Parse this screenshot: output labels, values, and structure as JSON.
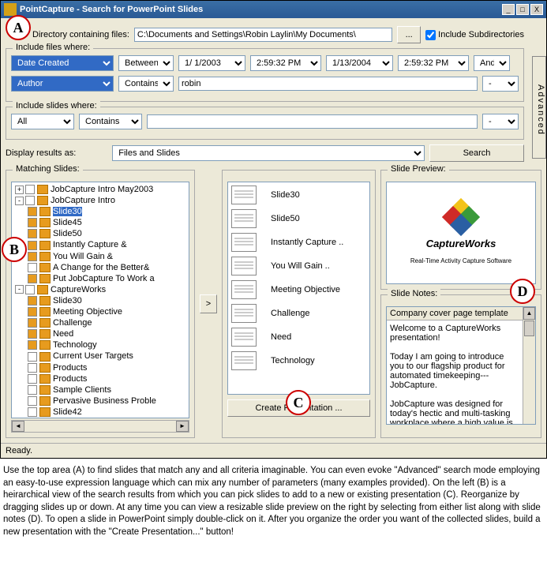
{
  "window": {
    "title": "PointCapture - Search for PowerPoint Slides",
    "min": "_",
    "max": "□",
    "close": "X"
  },
  "search": {
    "dir_label": "Directory containing files:",
    "dir_value": "C:\\Documents and Settings\\Robin Laylin\\My Documents\\",
    "browse": "...",
    "include_subdirs": "Include Subdirectories",
    "files_where": "Include files where:",
    "field1": "Date Created",
    "op1": "Between",
    "date1": "1/ 1/2003",
    "time1": "2:59:32 PM",
    "date2": "1/13/2004",
    "time2": "2:59:32 PM",
    "bool1": "And",
    "field2": "Author",
    "op2": "Contains",
    "val2": "robin",
    "bool2": "-",
    "slides_where": "Include slides where:",
    "sfield": "All",
    "sop": "Contains",
    "sval": "",
    "sbool": "-",
    "display_as_label": "Display results as:",
    "display_as": "Files and Slides",
    "search_btn": "Search",
    "advanced": "Advanced"
  },
  "panels": {
    "matching": "Matching Slides:",
    "preview": "Slide Preview:",
    "notes": "Slide Notes:"
  },
  "tree": [
    {
      "lvl": 0,
      "exp": "+",
      "chk": false,
      "txt": "JobCapture Intro May2003"
    },
    {
      "lvl": 0,
      "exp": "-",
      "chk": false,
      "txt": "JobCapture Intro"
    },
    {
      "lvl": 1,
      "chk": true,
      "txt": "Slide30",
      "sel": true
    },
    {
      "lvl": 1,
      "chk": true,
      "txt": "Slide45"
    },
    {
      "lvl": 1,
      "chk": true,
      "txt": "Slide50"
    },
    {
      "lvl": 1,
      "chk": true,
      "txt": "Instantly Capture &"
    },
    {
      "lvl": 1,
      "chk": true,
      "txt": "You Will Gain &"
    },
    {
      "lvl": 1,
      "chk": false,
      "txt": "A Change for the Better&"
    },
    {
      "lvl": 1,
      "chk": true,
      "txt": "Put JobCapture To Work a"
    },
    {
      "lvl": 0,
      "exp": "-",
      "chk": false,
      "txt": "CaptureWorks"
    },
    {
      "lvl": 1,
      "chk": true,
      "txt": "Slide30"
    },
    {
      "lvl": 1,
      "chk": true,
      "txt": "Meeting Objective"
    },
    {
      "lvl": 1,
      "chk": true,
      "txt": "Challenge"
    },
    {
      "lvl": 1,
      "chk": true,
      "txt": "Need"
    },
    {
      "lvl": 1,
      "chk": true,
      "txt": "Technology"
    },
    {
      "lvl": 1,
      "chk": false,
      "txt": "Current User Targets"
    },
    {
      "lvl": 1,
      "chk": false,
      "txt": "Products"
    },
    {
      "lvl": 1,
      "chk": false,
      "txt": "Products"
    },
    {
      "lvl": 1,
      "chk": false,
      "txt": "Sample Clients"
    },
    {
      "lvl": 1,
      "chk": false,
      "txt": "Pervasive Business Proble"
    },
    {
      "lvl": 1,
      "chk": false,
      "txt": "Slide42"
    }
  ],
  "thumbs": [
    "Slide30",
    "Slide50",
    "Instantly Capture ..",
    "You Will Gain ..",
    "Meeting Objective",
    "Challenge",
    "Need",
    "Technology"
  ],
  "mid_btn": ">",
  "create_btn": "Create Presentation ...",
  "preview": {
    "brand": "CaptureWorks",
    "tagline": "Real-Time Activity Capture Software"
  },
  "notes": {
    "header": "Company cover page template",
    "body": "Welcome to a CaptureWorks presentation!\n\nToday I am going to introduce you to our flagship product for automated timekeeping---JobCapture.\n\nJobCapture was designed for today's hectic and multi-tasking workplace where a high value is placed on accurate project tracking."
  },
  "status": "Ready.",
  "callouts": {
    "A": "A",
    "B": "B",
    "C": "C",
    "D": "D"
  },
  "caption": "Use the top area (A) to find slides that match any and all criteria imaginable. You can even evoke \"Advanced\" search mode employing an easy-to-use expression language which can mix any number of parameters (many examples provided). On the left (B) is a heirarchical view of the search results from which you can pick slides to add to a new or existing presentation (C). Reorganize by dragging slides up or down. At any time you can view a resizable slide preview on the right by selecting from either list along with slide notes (D). To open a slide in PowerPoint simply double-click on it. After you organize the order you want of the collected slides, build a new presentation with the \"Create Presentation...\" button!"
}
